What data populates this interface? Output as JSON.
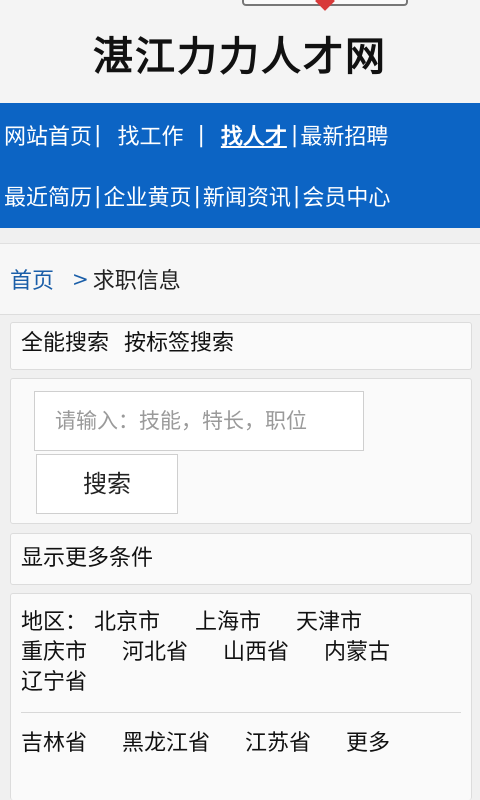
{
  "header": {
    "site_title": "湛江力力人才网"
  },
  "nav": {
    "row1": [
      "网站首页",
      "找工作",
      "找人才",
      "最新招聘"
    ],
    "row2": [
      "最近简历",
      "企业黄页",
      "新闻资讯",
      "会员中心"
    ],
    "active": "找人才",
    "separator": "|"
  },
  "breadcrumb": {
    "home": "首页",
    "arrow": ">",
    "current": "求职信息"
  },
  "search_tabs": {
    "full_search": "全能搜索",
    "tag_search": "按标签搜索"
  },
  "search": {
    "placeholder": "请输入：技能，特长，职位",
    "button": "搜索"
  },
  "more_conditions": "显示更多条件",
  "region": {
    "label": "地区：",
    "items": [
      "北京市",
      "上海市",
      "天津市",
      "重庆市",
      "河北省",
      "山西省",
      "内蒙古",
      "辽宁省",
      "吉林省",
      "黑龙江省",
      "江苏省"
    ],
    "more": "更多"
  },
  "colors": {
    "nav_bg": "#0c64c4",
    "link": "#1a5ea8"
  }
}
